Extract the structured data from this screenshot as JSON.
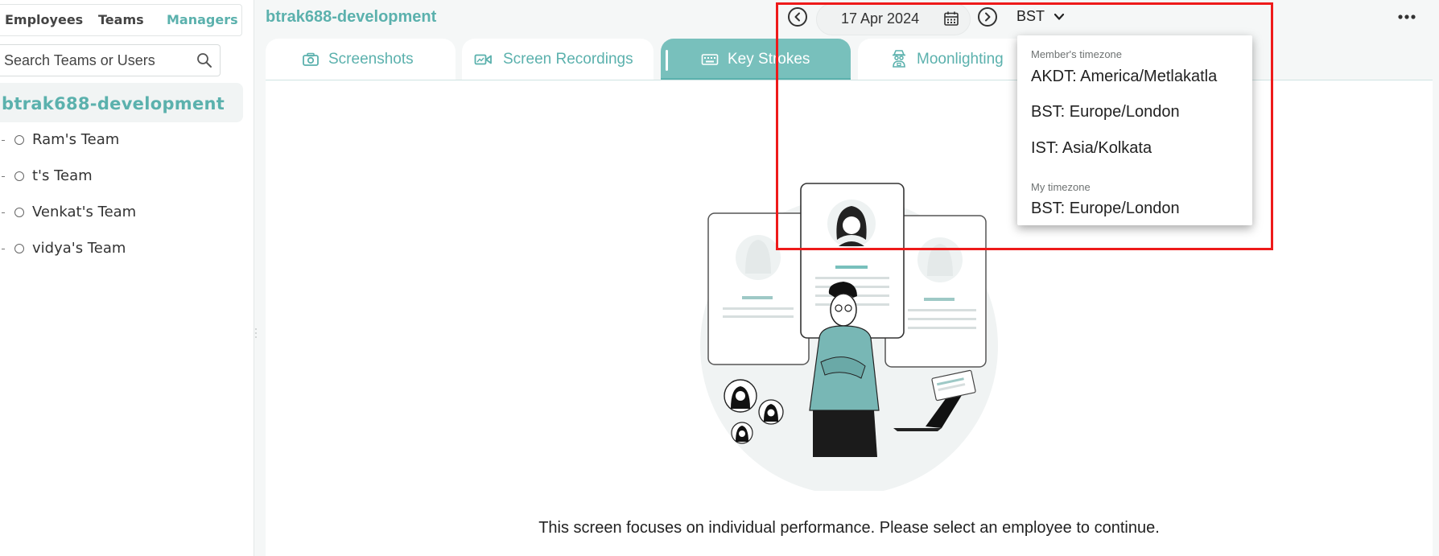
{
  "sidebar": {
    "tabs": [
      {
        "label": "Employees"
      },
      {
        "label": "Teams"
      },
      {
        "label": "Managers"
      }
    ],
    "search": {
      "placeholder": "Search Teams or Users"
    },
    "org_name": "btrak688-development",
    "teams": [
      {
        "label": "Ram's Team"
      },
      {
        "label": "t's Team"
      },
      {
        "label": "Venkat's Team"
      },
      {
        "label": "vidya's Team"
      }
    ]
  },
  "header": {
    "title": "btrak688-development",
    "date": "17 Apr 2024",
    "timezone": "BST"
  },
  "tabs": [
    {
      "label": "Screenshots",
      "icon": "camera-icon"
    },
    {
      "label": "Screen Recordings",
      "icon": "video-camera-icon"
    },
    {
      "label": "Key Strokes",
      "icon": "keyboard-icon",
      "active": true
    },
    {
      "label": "Moonlighting",
      "icon": "spy-icon"
    }
  ],
  "timezone_dropdown": {
    "member_label": "Member's timezone",
    "member_options": [
      {
        "label": "AKDT: America/Metlakatla"
      },
      {
        "label": "BST: Europe/London"
      },
      {
        "label": "IST: Asia/Kolkata"
      }
    ],
    "my_label": "My timezone",
    "my_options": [
      {
        "label": "BST: Europe/London"
      }
    ]
  },
  "main": {
    "empty_message": "This screen focuses on individual performance. Please select an employee to continue."
  },
  "colors": {
    "accent": "#5bb1ad",
    "active_tab": "#78c0bc",
    "highlight": "#ee1a1a"
  }
}
